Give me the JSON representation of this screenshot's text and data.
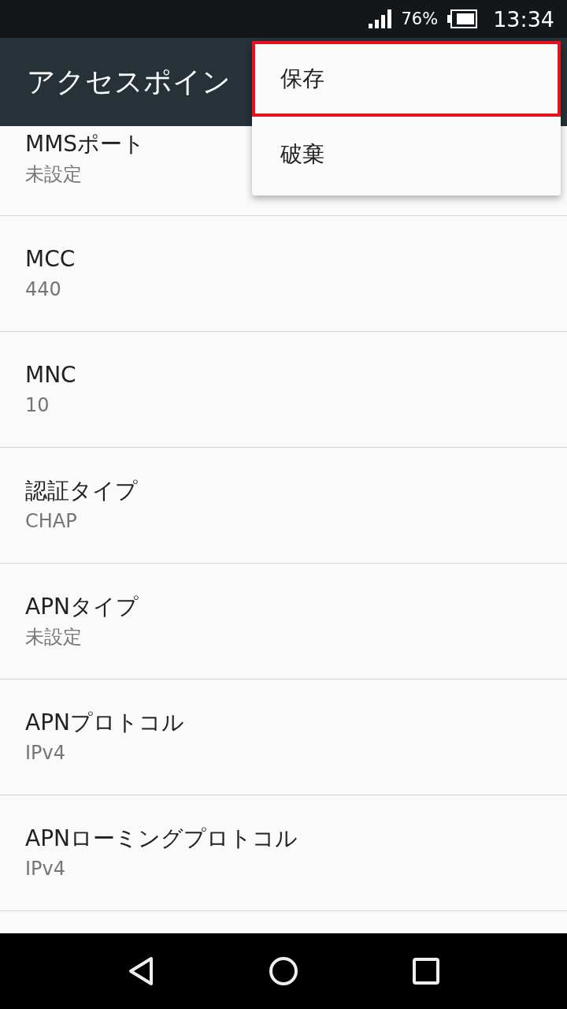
{
  "status_bar": {
    "battery": "76%",
    "time": "13:34"
  },
  "app_bar": {
    "title": "アクセスポイン"
  },
  "settings": [
    {
      "title": "MMSポート",
      "value": "未設定"
    },
    {
      "title": "MCC",
      "value": "440"
    },
    {
      "title": "MNC",
      "value": "10"
    },
    {
      "title": "認証タイプ",
      "value": "CHAP"
    },
    {
      "title": "APNタイプ",
      "value": "未設定"
    },
    {
      "title": "APNプロトコル",
      "value": "IPv4"
    },
    {
      "title": "APNローミングプロトコル",
      "value": "IPv4"
    }
  ],
  "menu": {
    "items": [
      {
        "label": "保存",
        "selected": true
      },
      {
        "label": "破棄",
        "selected": false
      }
    ]
  }
}
